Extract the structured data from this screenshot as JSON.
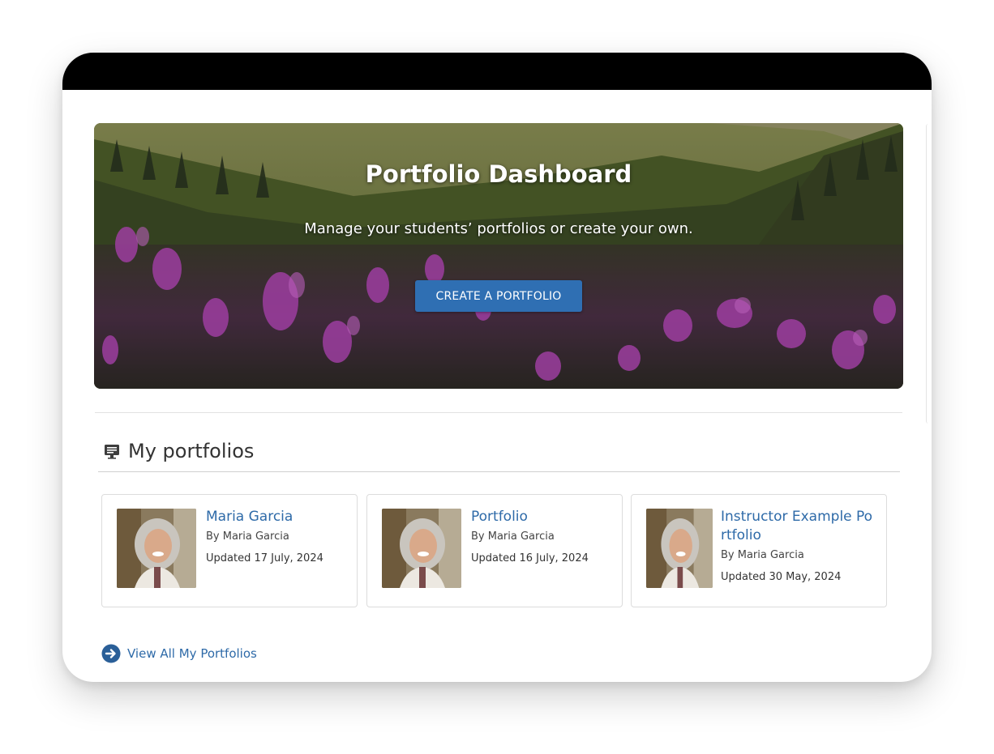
{
  "hero": {
    "title": "Portfolio Dashboard",
    "subtitle": "Manage your students’ portfolios or create your own.",
    "button_label": "CREATE A PORTFOLIO"
  },
  "section": {
    "title": "My portfolios",
    "icon": "presentation-board-icon"
  },
  "portfolios": [
    {
      "title": "Maria Garcia",
      "by": "By Maria Garcia",
      "updated": "Updated 17 July, 2024"
    },
    {
      "title": "Portfolio",
      "by": "By Maria Garcia",
      "updated": "Updated 16 July, 2024"
    },
    {
      "title": "Instructor Example Portfolio",
      "by": "By Maria Garcia",
      "updated": "Updated 30 May, 2024"
    }
  ],
  "view_all": {
    "label": "View All My Portfolios",
    "icon": "arrow-circle-right-icon"
  },
  "colors": {
    "link": "#2e6aa8",
    "button": "#2f6fb3",
    "topbar": "#000000"
  }
}
